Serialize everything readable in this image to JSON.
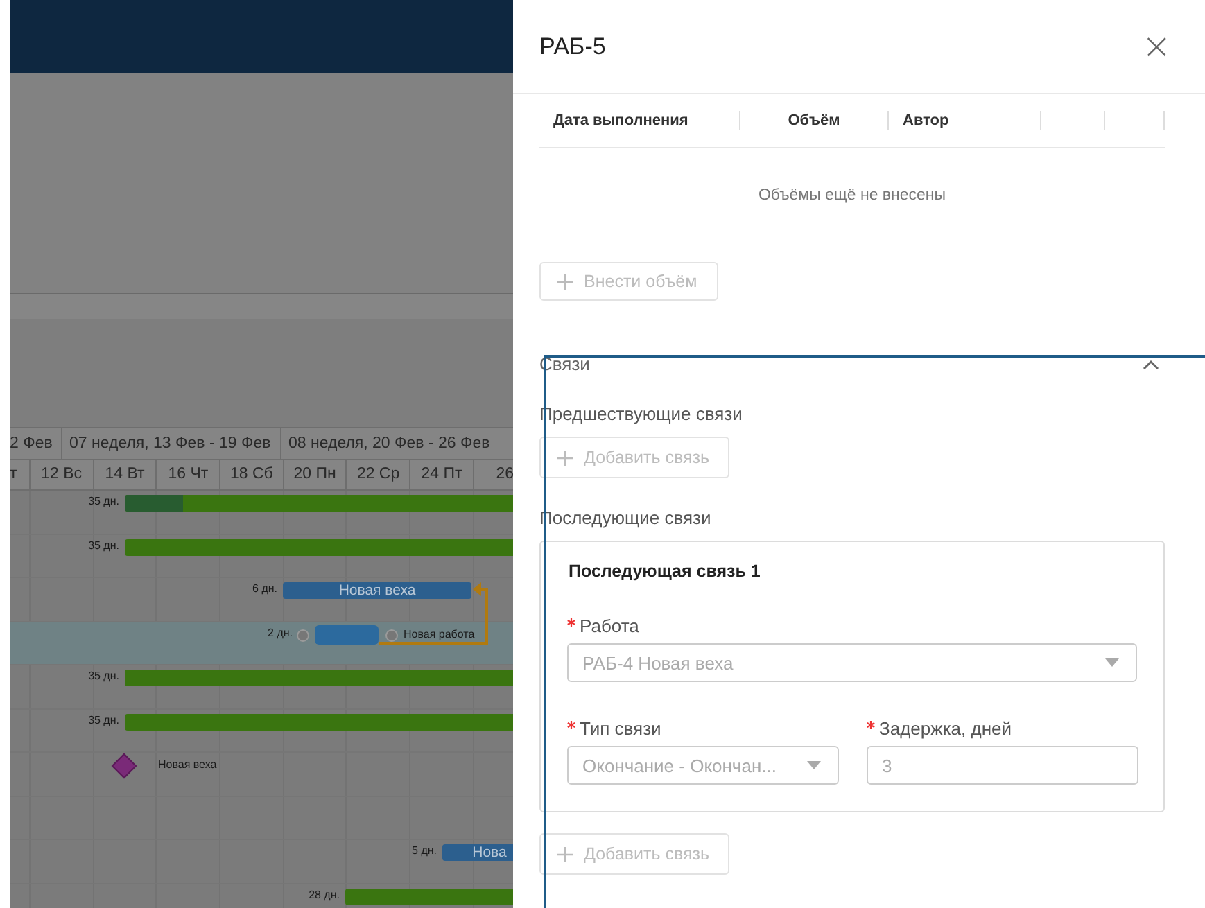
{
  "gantt": {
    "weeks": [
      "2 Фев",
      "07 неделя, 13 Фев - 19 Фев",
      "08 неделя, 20 Фев - 26 Фев"
    ],
    "days": [
      "т",
      "12 Вс",
      "14 Вт",
      "16 Чт",
      "18 Сб",
      "20 Пн",
      "22 Ср",
      "24 Пт",
      "26"
    ],
    "rows": [
      {
        "kind": "bar",
        "duration": "35 дн.",
        "color": "#3a7510",
        "level": 0.14,
        "highlighted": false
      },
      {
        "kind": "bar",
        "duration": "35 дн.",
        "color": "#3a7510",
        "highlighted": false
      },
      {
        "kind": "bar",
        "duration": "6 дн.",
        "color": "#2c5f8e",
        "label": "Новая веха",
        "highlighted": false
      },
      {
        "kind": "task",
        "duration": "2 дн.",
        "color": "#2c6a9e",
        "label": "Новая работа",
        "highlighted": true
      },
      {
        "kind": "bar",
        "duration": "35 дн.",
        "color": "#3a7510",
        "highlighted": false
      },
      {
        "kind": "bar",
        "duration": "35 дн.",
        "color": "#3a7510",
        "highlighted": false
      },
      {
        "kind": "milestone",
        "color": "#7a2a78",
        "label": "Новая веха",
        "highlighted": false
      },
      {
        "kind": "empty",
        "highlighted": false
      },
      {
        "kind": "bar",
        "duration": "5 дн.",
        "color": "#2c5f8e",
        "label": "Нова",
        "highlighted": false
      },
      {
        "kind": "bar",
        "duration": "28 дн.",
        "color": "#3a7510",
        "highlighted": false
      }
    ]
  },
  "panel": {
    "title": "РАБ-5",
    "close": "×",
    "volumes": {
      "columns": [
        "Дата выполнения",
        "Объём",
        "Автор"
      ],
      "empty_text": "Объёмы ещё не внесены",
      "add_button": "Внести объём",
      "add_disabled": true
    },
    "links": {
      "title": "Связи",
      "expanded": true,
      "predecessors": {
        "title": "Предшествующие связи",
        "add_button": "Добавить связь",
        "add_disabled": true
      },
      "successors": {
        "title": "Последующие связи",
        "items": [
          {
            "title": "Последующая связь 1",
            "work_label": "Работа",
            "work_value": "РАБ-4 Новая веха",
            "type_label": "Тип связи",
            "type_value": "Окончание - Окончан...",
            "delay_label": "Задержка, дней",
            "delay_value": "3",
            "work_required": true,
            "type_required": true,
            "delay_required": true,
            "disabled": true
          }
        ],
        "add_button": "Добавить связь",
        "add_disabled": true
      }
    }
  }
}
